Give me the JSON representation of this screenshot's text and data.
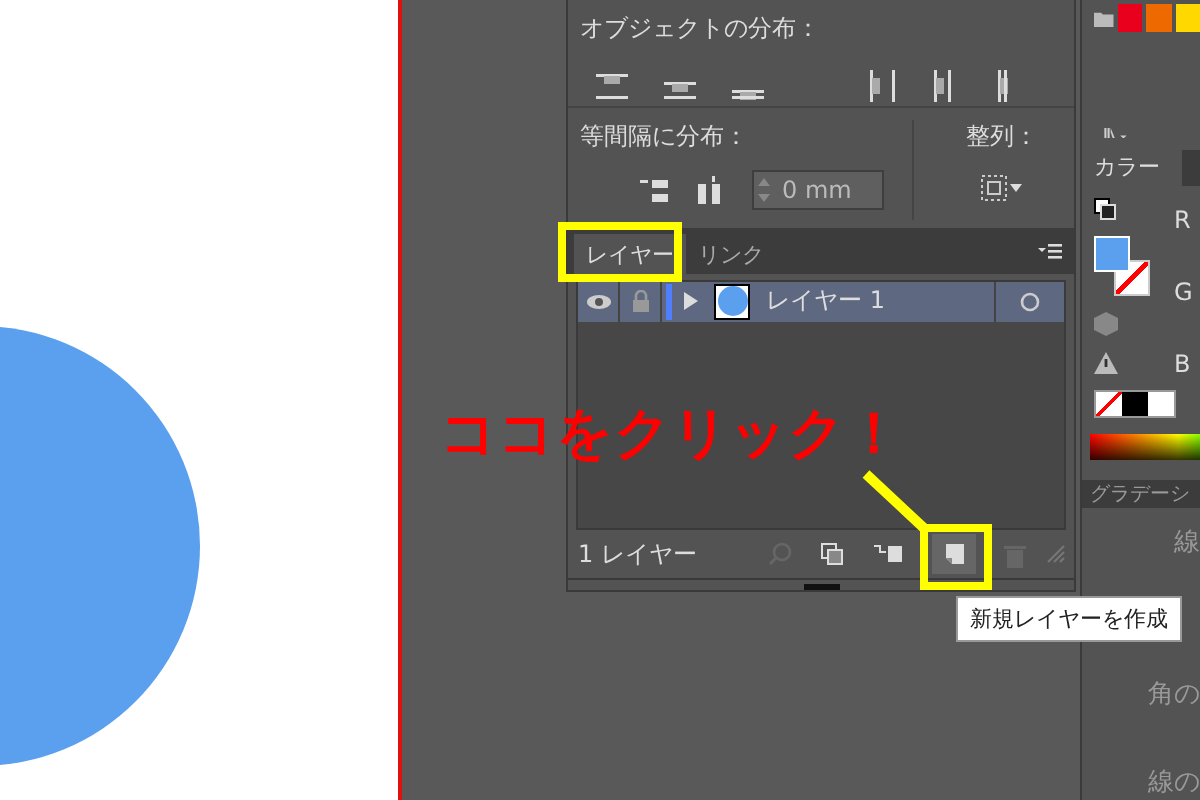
{
  "distribute_objects": {
    "title": "オブジェクトの分布："
  },
  "distribute_spacing": {
    "title": "等間隔に分布：",
    "spacing_value": "0 mm"
  },
  "align_to": {
    "title": "整列："
  },
  "layers_panel": {
    "tabs": [
      {
        "label": "レイヤー",
        "selected": true
      },
      {
        "label": "リンク",
        "selected": false
      }
    ],
    "layers": [
      {
        "name": "レイヤー 1",
        "color": "#4f7fff"
      }
    ],
    "layer_count": "1 レイヤー"
  },
  "tooltip": "新規レイヤーを作成",
  "annotation": "ココをクリック！",
  "color_panel": {
    "tab": "カラー",
    "channels": [
      "R",
      "G",
      "B"
    ]
  },
  "gradient_panel": {
    "tab": "グラデーシ"
  },
  "stroke_panel": {
    "labels": [
      "線",
      "角の",
      "線の"
    ]
  }
}
